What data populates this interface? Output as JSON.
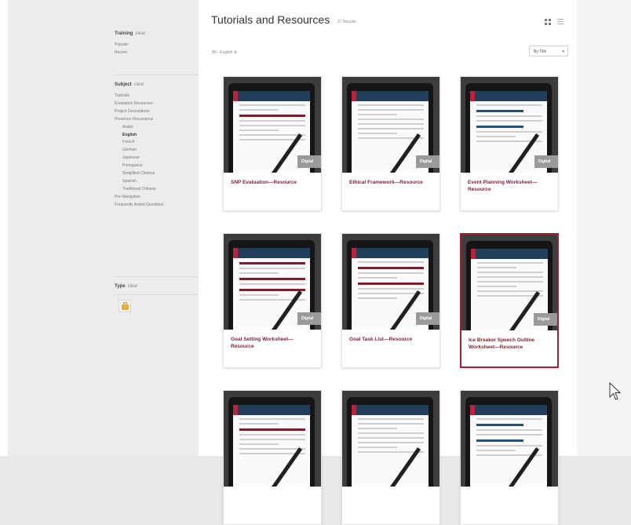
{
  "sidebar": {
    "training": {
      "heading": "Training",
      "clear": "clear",
      "items": [
        "Popular",
        "Recent"
      ]
    },
    "subject": {
      "heading": "Subject",
      "clear": "clear",
      "items": [
        {
          "label": "Tutorials",
          "indent": false,
          "active": false
        },
        {
          "label": "Evaluation Resources",
          "indent": false,
          "active": false
        },
        {
          "label": "Project Descriptions",
          "indent": false,
          "active": false
        },
        {
          "label": "Presence Discussions",
          "indent": false,
          "active": false
        },
        {
          "label": "Arabic",
          "indent": true,
          "active": false
        },
        {
          "label": "English",
          "indent": true,
          "active": true
        },
        {
          "label": "French",
          "indent": true,
          "active": false
        },
        {
          "label": "German",
          "indent": true,
          "active": false
        },
        {
          "label": "Japanese",
          "indent": true,
          "active": false
        },
        {
          "label": "Portuguese",
          "indent": true,
          "active": false
        },
        {
          "label": "Simplified Chinese",
          "indent": true,
          "active": false
        },
        {
          "label": "Spanish",
          "indent": true,
          "active": false
        },
        {
          "label": "Traditional Chinese",
          "indent": true,
          "active": false
        },
        {
          "label": "Pre-Navigation",
          "indent": false,
          "active": false
        },
        {
          "label": "Frequently Asked Questions",
          "indent": false,
          "active": false
        }
      ]
    },
    "type": {
      "heading": "Type",
      "clear": "clear",
      "icon": "briefcase-icon"
    }
  },
  "main": {
    "title": "Tutorials and Resources",
    "count": "37 Results",
    "breadcrumb": "All  ›  English ⊗",
    "sort_label": "By Title",
    "sort_caret": "▾",
    "overlay_label": "Digital",
    "cards": [
      {
        "title": "SNP Evaluation—Resource",
        "selected": false
      },
      {
        "title": "Ethical Framework—Resource",
        "selected": false
      },
      {
        "title": "Event Planning Worksheet—Resource",
        "selected": false
      },
      {
        "title": "Goal Setting Worksheet—Resource",
        "selected": false
      },
      {
        "title": "Goal Task List—Resource",
        "selected": false
      },
      {
        "title": "Ice Breaker Speech Outline Worksheet—Resource",
        "selected": true
      },
      {
        "title": "",
        "selected": false
      },
      {
        "title": "",
        "selected": false
      },
      {
        "title": "",
        "selected": false
      }
    ]
  },
  "colors": {
    "accent": "#a31f35",
    "card_title": "#7a1f30",
    "doc_header": "#1f3f5c"
  }
}
